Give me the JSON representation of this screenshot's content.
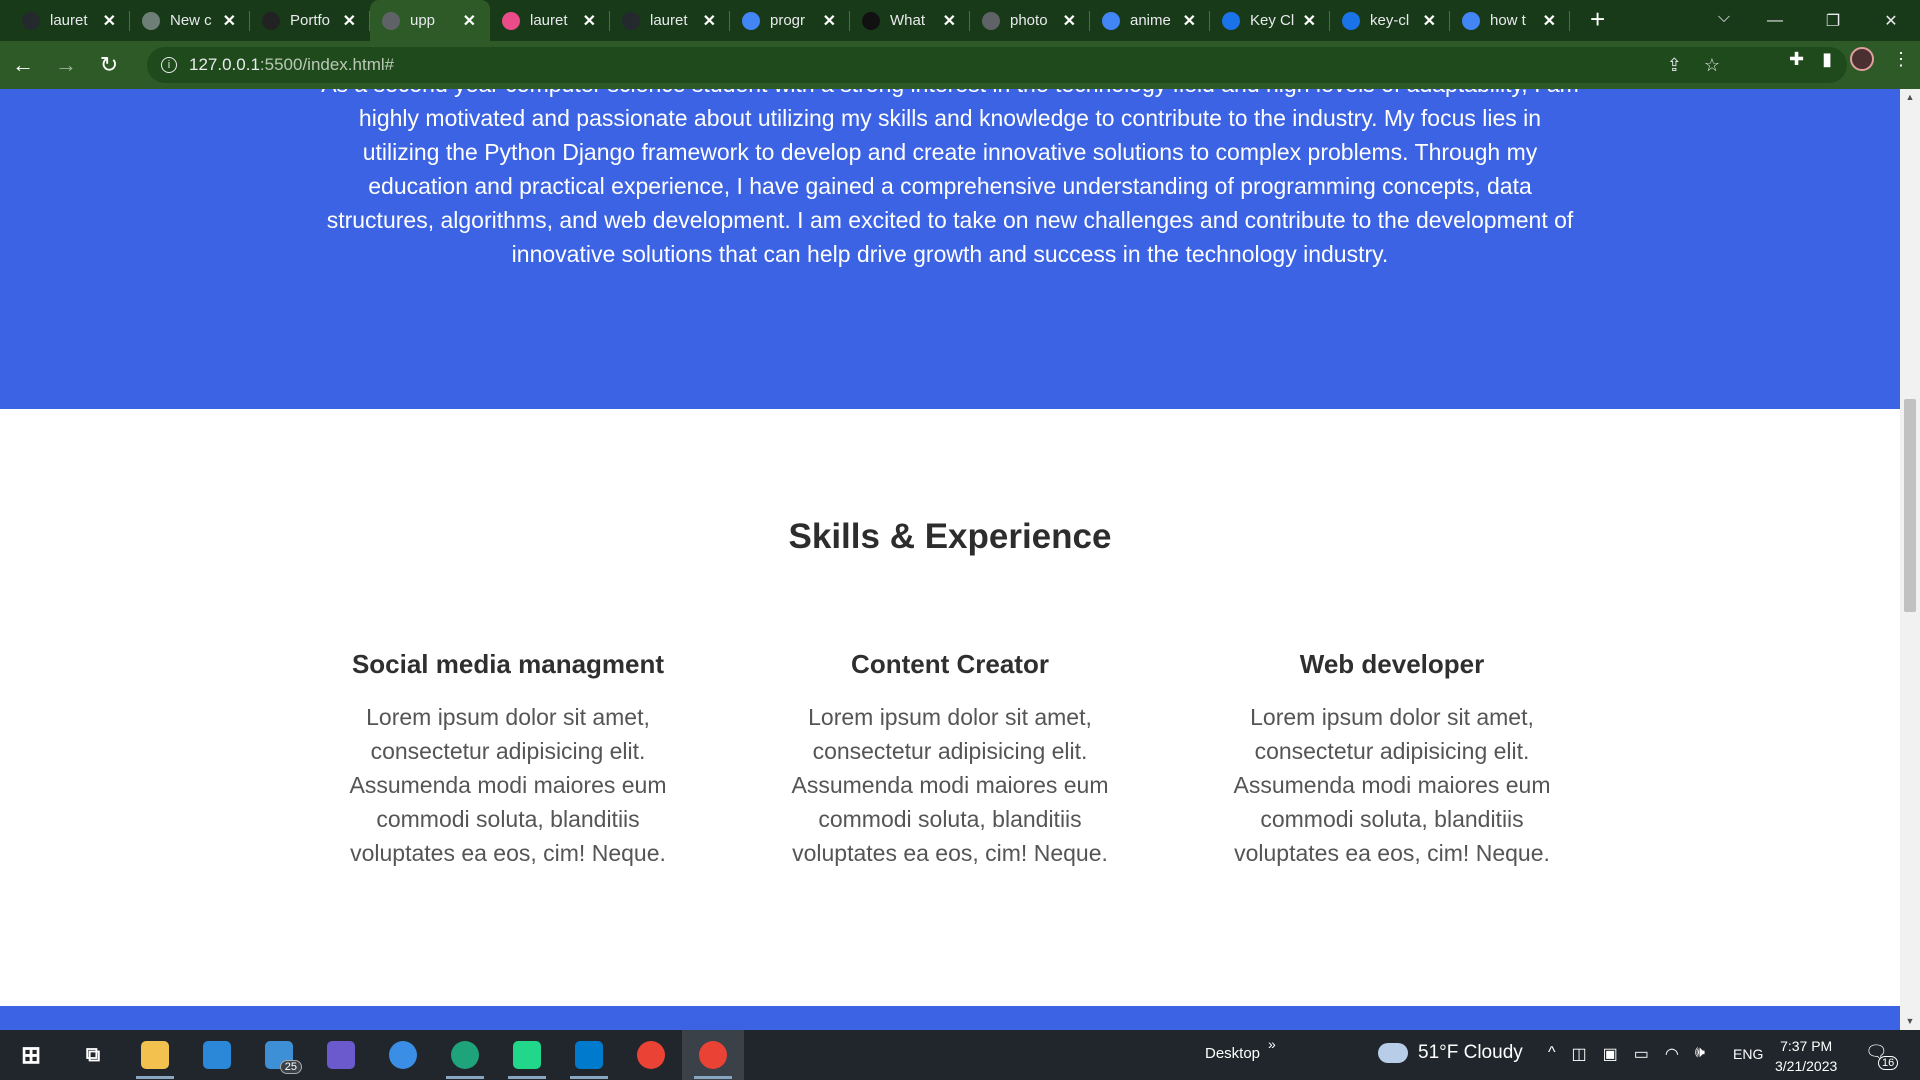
{
  "browser": {
    "tabs": [
      {
        "title": "lauret",
        "favicon": "github-icon",
        "color": "#24292e"
      },
      {
        "title": "New c",
        "favicon": "chatgpt-icon",
        "color": "#6e7f77"
      },
      {
        "title": "Portfo",
        "favicon": "codepen-icon",
        "color": "#222222"
      },
      {
        "title": "upp",
        "favicon": "globe-icon",
        "color": "#5f6368",
        "active": true
      },
      {
        "title": "lauret",
        "favicon": "dribbble-icon",
        "color": "#ea4c89"
      },
      {
        "title": "lauret",
        "favicon": "github-icon",
        "color": "#24292e"
      },
      {
        "title": "progr",
        "favicon": "google-icon",
        "color": "#4285f4"
      },
      {
        "title": "What",
        "favicon": "f-icon",
        "color": "#111111"
      },
      {
        "title": "photo",
        "favicon": "globe-icon",
        "color": "#5f6368"
      },
      {
        "title": "anime",
        "favicon": "google-icon",
        "color": "#4285f4"
      },
      {
        "title": "Key Cl",
        "favicon": "gif-icon",
        "color": "#1a73e8"
      },
      {
        "title": "key-cl",
        "favicon": "gif-icon",
        "color": "#1a73e8"
      },
      {
        "title": "how t",
        "favicon": "google-icon",
        "color": "#4285f4"
      }
    ],
    "url_host": "127.0.0.1",
    "url_path": ":5500/index.html#"
  },
  "page": {
    "about_text": "As a second year computer science student with a strong interest in the technology field and high levels of adaptability, I am highly motivated and passionate about utilizing my skills and knowledge to contribute to the industry. My focus lies in utilizing the Python Django framework to develop and create innovative solutions to complex problems. Through my education and practical experience, I have gained a comprehensive understanding of programming concepts, data structures, algorithms, and web development. I am excited to take on new challenges and contribute to the development of innovative solutions that can help drive growth and success in the technology industry.",
    "skills_title": "Skills & Experience",
    "skills": [
      {
        "title": "Social media managment",
        "text": "Lorem ipsum dolor sit amet, consectetur adipisicing elit. Assumenda modi maiores eum commodi soluta, blanditiis voluptates ea eos, cim! Neque."
      },
      {
        "title": "Content Creator",
        "text": "Lorem ipsum dolor sit amet, consectetur adipisicing elit. Assumenda modi maiores eum commodi soluta, blanditiis voluptates ea eos, cim! Neque."
      },
      {
        "title": "Web developer",
        "text": "Lorem ipsum dolor sit amet, consectetur adipisicing elit. Assumenda modi maiores eum commodi soluta, blanditiis voluptates ea eos, cim! Neque."
      }
    ],
    "accent_color": "#3b63e4"
  },
  "taskbar": {
    "apps": [
      {
        "name": "start-icon",
        "color": "#ffffff"
      },
      {
        "name": "task-view-icon",
        "color": "#ffffff"
      },
      {
        "name": "file-explorer-icon",
        "color": "#f2c14e",
        "running": true
      },
      {
        "name": "microsoft-store-icon",
        "color": "#2b88d8"
      },
      {
        "name": "mail-icon",
        "color": "#3d8fd6",
        "badge": "25"
      },
      {
        "name": "power-automate-icon",
        "color": "#6a5acd"
      },
      {
        "name": "cortana-icon",
        "color": "#3a8ee6"
      },
      {
        "name": "edge-icon",
        "color": "#1fa37a",
        "running": true
      },
      {
        "name": "pycharm-icon",
        "color": "#21d789",
        "running": true
      },
      {
        "name": "vscode-icon",
        "color": "#007acc",
        "running": true
      },
      {
        "name": "chrome-icon",
        "color": "#ea4335"
      },
      {
        "name": "chrome-profile-icon",
        "color": "#ea4335",
        "running": true,
        "active": true
      }
    ],
    "desktop_label": "Desktop",
    "weather": "51°F  Cloudy",
    "language": "ENG",
    "time": "7:37 PM",
    "date": "3/21/2023",
    "notification_count": "16"
  }
}
